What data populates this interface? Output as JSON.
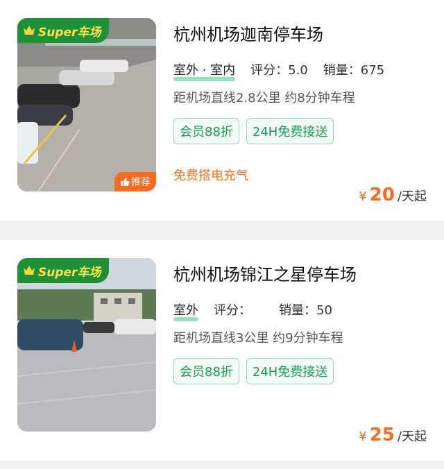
{
  "listings": [
    {
      "badge": "Super车场",
      "recommend_label": "推荐",
      "title": "杭州机场迦南停车场",
      "location_type": "室外 · 室内",
      "score_label": "评分：5.0",
      "sales_label": "销量：675",
      "distance": "距机场直线2.8公里 约8分钟车程",
      "tags": [
        "会员88折",
        "24H免费接送"
      ],
      "service": "免费搭电充气",
      "price_currency": "¥",
      "price_amount": "20",
      "price_unit": "/天起"
    },
    {
      "badge": "Super车场",
      "title": "杭州机场锦江之星停车场",
      "location_type": "室外",
      "score_label": "评分：",
      "sales_label": "销量：50",
      "distance": "距机场直线3公里 约9分钟车程",
      "tags": [
        "会员88折",
        "24H免费接送"
      ],
      "price_currency": "¥",
      "price_amount": "25",
      "price_unit": "/天起"
    }
  ],
  "colors": {
    "accent_green": "#1f8f38",
    "price_orange": "#f26d21",
    "tag_green": "#1b9a55"
  }
}
